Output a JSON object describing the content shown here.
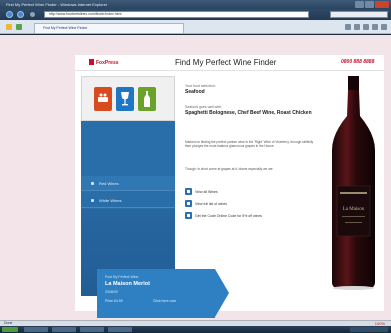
{
  "window": {
    "title": "Find My Perfect Wine Finder - Windows Internet Explorer"
  },
  "toolbar": {
    "url": "http://www.fourbertslines.com/finder/index.html"
  },
  "tab": {
    "label": "Find My Perfect Wine Finder"
  },
  "site": {
    "logo": "FoxPress",
    "title": "Find My Perfect Wine Finder",
    "phone": "0800 888 8888"
  },
  "categories": [
    {
      "icon": "food-icon",
      "color": "#d84a1f"
    },
    {
      "icon": "wine-glass-icon",
      "color": "#1e76c4"
    },
    {
      "icon": "wine-bottle-icon",
      "color": "#6aa32a"
    }
  ],
  "sidebar": {
    "links": [
      "Red Wines",
      "White Wines"
    ]
  },
  "result": {
    "selection_label": "Your food selection:",
    "selection_value": "Seafood",
    "match_label": "Seafood goes well with:",
    "wine_name": "Spaghetti Bolognese, Chef Beef Wine, Roast Chicken",
    "description": "Marked on finding the perfect partner wine is the 'Right' Wine of Vineberry, through skillfully then plunges the most balance glamorous grapes in the House",
    "hint": "Though: in short some at grapes at it, blame especially we are",
    "options": [
      "View all Wines",
      "View full list of wines",
      "Get the Code Online Code for 5% off wines"
    ]
  },
  "promo": {
    "label": "Find My Perfect Wine",
    "wine": "La Maison Merlot",
    "vintage": "2008/09",
    "price": "Price £4.99",
    "cta": "Click here now"
  },
  "bottle": {
    "label": "La Maison"
  },
  "status": {
    "text": "Done",
    "zoom": "100%"
  }
}
